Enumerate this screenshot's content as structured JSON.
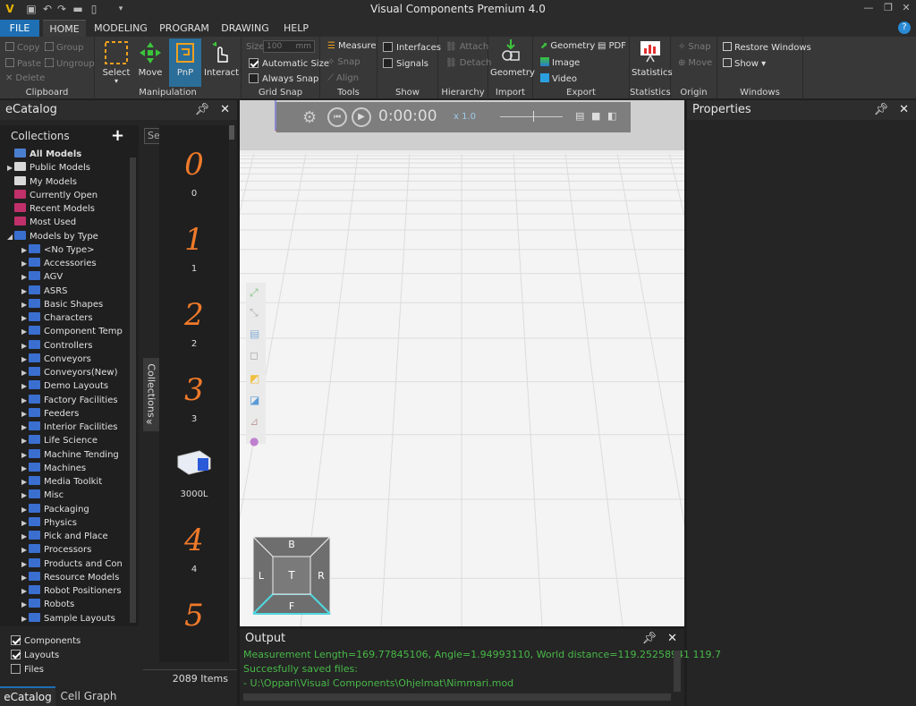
{
  "window": {
    "title": "Visual Components Premium 4.0"
  },
  "menu": {
    "tabs": [
      "FILE",
      "HOME",
      "MODELING",
      "PROGRAM",
      "DRAWING",
      "HELP"
    ],
    "active": "HOME",
    "help": "?"
  },
  "ribbon": {
    "clipboard": {
      "label": "Clipboard",
      "copy": "Copy",
      "paste": "Paste",
      "delete": "Delete",
      "group": "Group",
      "ungroup": "Ungroup"
    },
    "manipulation": {
      "label": "Manipulation",
      "select": "Select",
      "move": "Move",
      "pnp": "PnP",
      "interact": "Interact"
    },
    "gridsnap": {
      "label": "Grid Snap",
      "size_label": "Size",
      "size_value": "100",
      "size_unit": "mm",
      "auto_size": "Automatic Size",
      "always_snap": "Always Snap"
    },
    "tools": {
      "label": "Tools",
      "measure": "Measure",
      "snap": "Snap",
      "align": "Align"
    },
    "show": {
      "label": "Show",
      "interfaces": "Interfaces",
      "signals": "Signals"
    },
    "hierarchy": {
      "label": "Hierarchy",
      "attach": "Attach",
      "detach": "Detach"
    },
    "import": {
      "label": "Import",
      "geometry": "Geometry"
    },
    "export": {
      "label": "Export",
      "geometry": "Geometry",
      "image": "Image",
      "video": "Video",
      "pdf": "PDF"
    },
    "statistics": {
      "label": "Statistics",
      "statistics": "Statistics"
    },
    "origin": {
      "label": "Origin",
      "snap": "Snap",
      "move": "Move"
    },
    "windows": {
      "label": "Windows",
      "restore": "Restore Windows",
      "show": "Show ▾"
    }
  },
  "ecatalog": {
    "title": "eCatalog",
    "collections_header": "Collections",
    "search_placeholder": "Sea",
    "top_items": [
      {
        "label": "All Models",
        "color": "#4a7fd0",
        "bold": true,
        "arrow": ""
      },
      {
        "label": "Public Models",
        "color": "#d8d8d8",
        "arrow": "▶"
      },
      {
        "label": "My Models",
        "color": "#d8d8d8",
        "arrow": ""
      },
      {
        "label": "Currently Open",
        "color": "#c0306a",
        "arrow": ""
      },
      {
        "label": "Recent Models",
        "color": "#c0306a",
        "arrow": ""
      },
      {
        "label": "Most Used",
        "color": "#c0306a",
        "arrow": ""
      },
      {
        "label": "Models by Type",
        "color": "#3a6fd0",
        "arrow": "◢"
      }
    ],
    "type_items": [
      "<No Type>",
      "Accessories",
      "AGV",
      "ASRS",
      "Basic Shapes",
      "Characters",
      "Component Temp",
      "Controllers",
      "Conveyors",
      "Conveyors(New)",
      "Demo Layouts",
      "Factory Facilities",
      "Feeders",
      "Interior Facilities",
      "Life Science",
      "Machine Tending",
      "Machines",
      "Media Toolkit",
      "Misc",
      "Packaging",
      "Physics",
      "Pick and Place",
      "Processors",
      "Products and Con",
      "Resource Models",
      "Robot Positioners",
      "Robots",
      "Sample Layouts"
    ],
    "filters": [
      {
        "label": "Components",
        "checked": true
      },
      {
        "label": "Layouts",
        "checked": true
      },
      {
        "label": "Files",
        "checked": false
      }
    ],
    "side_tab": "Collections",
    "models": [
      {
        "glyph": "0",
        "label": "0"
      },
      {
        "glyph": "1",
        "label": "1"
      },
      {
        "glyph": "2",
        "label": "2"
      },
      {
        "glyph": "3",
        "label": "3"
      },
      {
        "glyph": "",
        "label": "3000L"
      },
      {
        "glyph": "4",
        "label": "4"
      },
      {
        "glyph": "5",
        "label": ""
      }
    ],
    "count": "2089 Items"
  },
  "bottom_tabs": [
    "eCatalog",
    "Cell Graph"
  ],
  "viewport": {
    "time": "0:00:00",
    "speed": "x 1.0",
    "cube": {
      "top": "T",
      "back": "B",
      "left": "L",
      "right": "R",
      "front": "F"
    }
  },
  "properties": {
    "title": "Properties"
  },
  "output": {
    "title": "Output",
    "lines": [
      {
        "text": "Measurement Length=169.77845106, Angle=1.94993110, World distance=119.25258941 119.7",
        "color": "#48b848"
      },
      {
        "text": "Succesfully saved files:",
        "color": "#48b848"
      },
      {
        "text": "- U:\\Oppari\\Visual Components\\Ohjelmat\\Nimmari.mod",
        "color": "#48b848"
      }
    ]
  },
  "colors": {
    "accent": "#1e6fb3",
    "number_orange": "#f07a2a",
    "output_green": "#48b848"
  }
}
